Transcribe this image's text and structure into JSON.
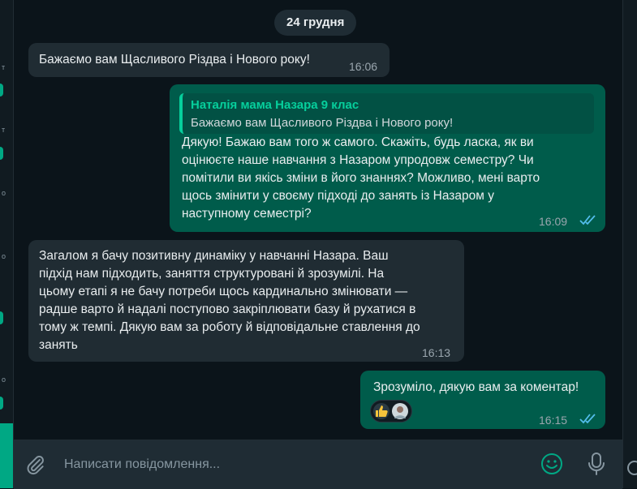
{
  "date_separator": "24 грудня",
  "messages": [
    {
      "direction": "incoming",
      "text": "Бажаємо вам Щасливого Різдва і Нового року!",
      "time": "16:06"
    },
    {
      "direction": "outgoing",
      "quote": {
        "author": "Наталія мама Назара 9 клас",
        "text": "Бажаємо вам Щасливого Різдва і Нового року!"
      },
      "text": "Дякую! Бажаю вам того ж самого. Скажіть, будь ласка, як ви\nоцінюєте наше навчання з Назаром упродовж семестру? Чи\nпомітили ви якісь зміни в його знаннях? Можливо, мені варто\nщось змінити у своєму підході до занять із Назаром у\nнаступному семестрі?",
      "time": "16:09",
      "status": "read"
    },
    {
      "direction": "incoming",
      "text": "Загалом я бачу позитивну динаміку у навчанні Назара. Ваш\nпідхід нам підходить, заняття структуровані й зрозумілі. На\nцьому етапі я не бачу потреби щось кардинально змінювати —\nрадше варто й надалі поступово закріплювати базу й рухатися в\nтому ж темпі. Дякую вам за роботу й відповідальне ставлення до\nзанять",
      "time": "16:13"
    },
    {
      "direction": "outgoing",
      "text": "Зрозуміло, дякую вам за коментар!",
      "time": "16:15",
      "status": "read",
      "reactions": [
        "thumbs-up",
        "avatar"
      ]
    }
  ],
  "composer": {
    "placeholder": "Написати повідомлення..."
  },
  "colors": {
    "background": "#0b141a",
    "incoming": "#202c33",
    "outgoing": "#005c4b",
    "accent": "#06cf9c",
    "read_ticks": "#53bdeb"
  }
}
